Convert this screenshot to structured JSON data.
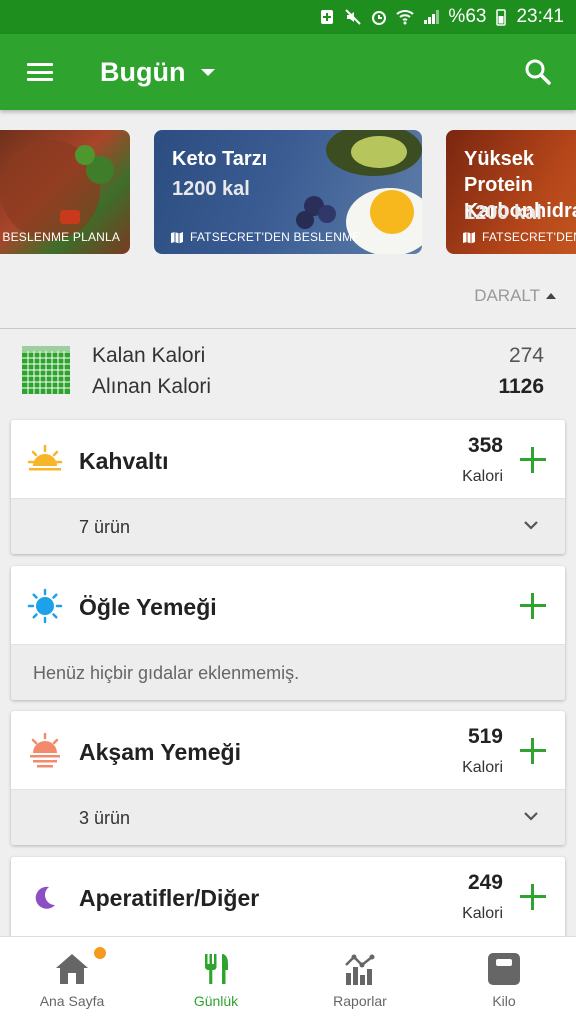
{
  "status_bar": {
    "battery": "%63",
    "time": "23:41"
  },
  "app_bar": {
    "title": "Bugün",
    "menu_icon": "menu-icon",
    "search_icon": "search-icon"
  },
  "carousel": [
    {
      "title": "",
      "kcal": "",
      "source": "N BESLENME PLANLA",
      "colors": [
        "#7a3a22",
        "#4a2a1a"
      ]
    },
    {
      "title": "Keto Tarzı",
      "kcal": "1200 kal",
      "source": "FATSECRET'DEN BESLENME",
      "colors": [
        "#2f4f82",
        "#4d6ea6"
      ]
    },
    {
      "title": "Yüksek Protein Karbonhidrat",
      "kcal": "1200 kal",
      "source": "FATSECRET'DEN",
      "colors": [
        "#8a2d10",
        "#b5481c"
      ]
    }
  ],
  "collapse_label": "DARALT",
  "summary": {
    "remaining_label": "Kalan Kalori",
    "remaining_value": "274",
    "consumed_label": "Alınan Kalori",
    "consumed_value": "1126"
  },
  "meals": [
    {
      "name": "Kahvaltı",
      "calories": "358",
      "cal_label": "Kalori",
      "footer": "7 ürün",
      "icon": "sunrise-icon"
    },
    {
      "name": "Öğle Yemeği",
      "calories": "",
      "cal_label": "",
      "footer": "Henüz hiçbir gıdalar eklenmemiş.",
      "icon": "sun-icon"
    },
    {
      "name": "Akşam Yemeği",
      "calories": "519",
      "cal_label": "Kalori",
      "footer": "3 ürün",
      "icon": "sunset-icon"
    },
    {
      "name": "Aperatifler/Diğer",
      "calories": "249",
      "cal_label": "Kalori",
      "footer": "",
      "icon": "moon-icon"
    }
  ],
  "bottom_nav": [
    {
      "label": "Ana Sayfa",
      "icon": "home-icon",
      "active": false
    },
    {
      "label": "Günlük",
      "icon": "fork-knife-icon",
      "active": true
    },
    {
      "label": "Raporlar",
      "icon": "chart-icon",
      "active": false
    },
    {
      "label": "Kilo",
      "icon": "scale-icon",
      "active": false
    }
  ],
  "colors": {
    "primary": "#2ea42e",
    "status_bar": "#1e8e1e",
    "accent_dot": "#f39a1f"
  }
}
